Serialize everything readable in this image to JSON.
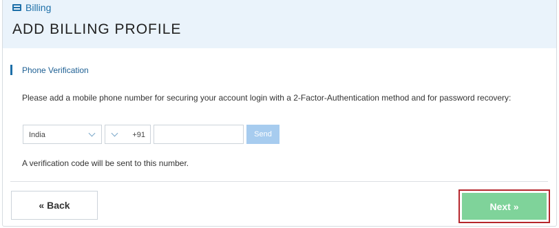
{
  "header": {
    "breadcrumb_icon": "credit-card-icon",
    "breadcrumb_label": "Billing",
    "title": "ADD BILLING PROFILE"
  },
  "section": {
    "title": "Phone Verification",
    "instruction": "Please add a mobile phone number for securing your account login with a 2-Factor-Authentication method and for password recovery:"
  },
  "phone_form": {
    "country_selected": "India",
    "dial_code": "+91",
    "phone_value": "",
    "send_label": "Send"
  },
  "note": "A verification code will be sent to this number.",
  "footer": {
    "back_label": "« Back",
    "next_label": "Next »"
  },
  "colors": {
    "accent": "#1d6fa8",
    "header_bg": "#eaf3fb",
    "send_disabled": "#a7ccef",
    "next_green": "#7fd39a",
    "highlight_red": "#b5262c"
  }
}
